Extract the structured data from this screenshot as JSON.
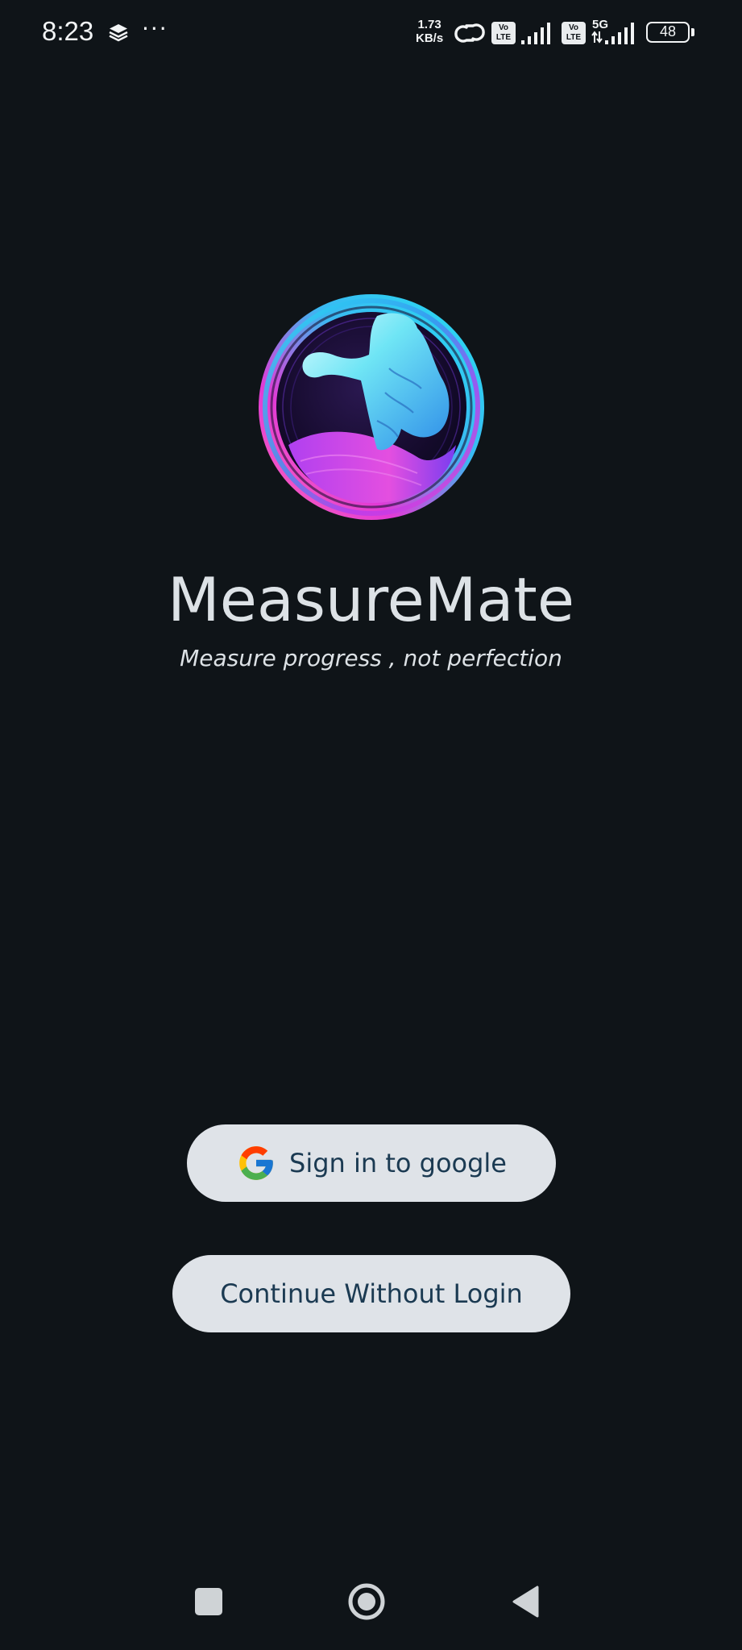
{
  "status_bar": {
    "time": "8:23",
    "net_speed_value": "1.73",
    "net_speed_unit": "KB/s",
    "volte_label_top": "Vo",
    "volte_label_bottom": "LTE",
    "network_type": "5G",
    "battery_level": "48",
    "icons": [
      "layers-icon",
      "more-dots-icon",
      "hotspot-link-icon",
      "volte-icon",
      "signal-icon",
      "volte-icon",
      "5g-signal-icon",
      "battery-icon"
    ]
  },
  "logo": {
    "icon": "measuremate-logo",
    "colors": {
      "ring_cyan": "#27e0f0",
      "ring_magenta": "#e23ad6",
      "ring_purple": "#7a35f0",
      "inner_dark": "#1a0f33"
    }
  },
  "app": {
    "title": "MeasureMate",
    "tagline": "Measure progress , not perfection"
  },
  "actions": {
    "google_signin_label": "Sign in to google",
    "continue_label": "Continue Without Login",
    "button_bg": "#dfe3e8",
    "button_text_color": "#1b3a52"
  },
  "nav_bar": {
    "icons": [
      "recents-square-icon",
      "home-circle-icon",
      "back-triangle-icon"
    ]
  },
  "theme": {
    "background": "#0f1418",
    "text": "#dde2e6"
  }
}
